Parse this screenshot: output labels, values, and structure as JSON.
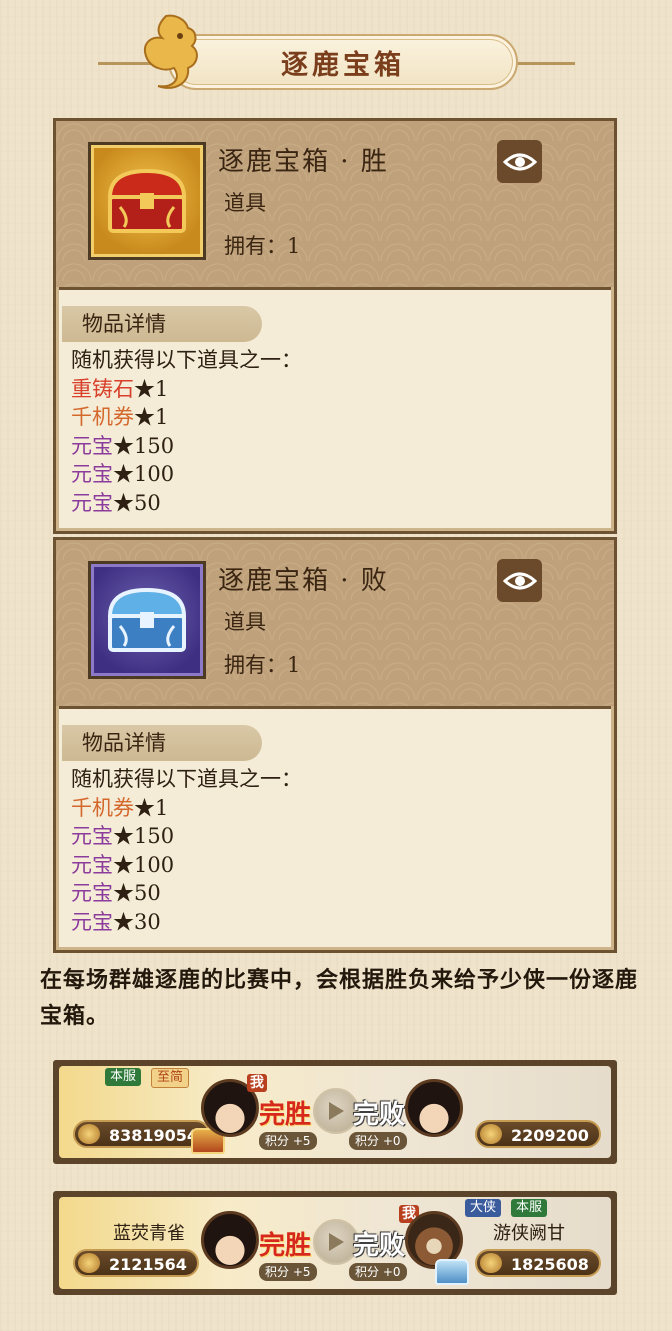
{
  "header": {
    "title": "逐鹿宝箱",
    "icon": "golden-bird-icon"
  },
  "cards": [
    {
      "name": "逐鹿宝箱 · 胜",
      "type": "道具",
      "owned": "拥有：1",
      "chest_color": "gold",
      "detail_tab": "物品详情",
      "intro": "随机获得以下道具之一：",
      "rewards": [
        {
          "text": "重铸石",
          "qty": "★1",
          "color": "#d8402b"
        },
        {
          "text": "千机券",
          "qty": "★1",
          "color": "#d4682c"
        },
        {
          "text": "元宝",
          "qty": "★150",
          "color": "#8b3b9c"
        },
        {
          "text": "元宝",
          "qty": "★100",
          "color": "#8b3b9c"
        },
        {
          "text": "元宝",
          "qty": "★50",
          "color": "#8b3b9c"
        }
      ]
    },
    {
      "name": "逐鹿宝箱 · 败",
      "type": "道具",
      "owned": "拥有：1",
      "chest_color": "blue",
      "detail_tab": "物品详情",
      "intro": "随机获得以下道具之一：",
      "rewards": [
        {
          "text": "千机券",
          "qty": "★1",
          "color": "#d4682c"
        },
        {
          "text": "元宝",
          "qty": "★150",
          "color": "#8b3b9c"
        },
        {
          "text": "元宝",
          "qty": "★100",
          "color": "#8b3b9c"
        },
        {
          "text": "元宝",
          "qty": "★50",
          "color": "#8b3b9c"
        },
        {
          "text": "元宝",
          "qty": "★30",
          "color": "#8b3b9c"
        }
      ]
    }
  ],
  "description": "在每场群雄逐鹿的比赛中，会根据胜负来给予少侠一份逐鹿宝箱。",
  "matches": [
    {
      "left": {
        "server_tag": "本服",
        "rank_tag": "至简",
        "score": "83819054",
        "me_badge": "我"
      },
      "right": {
        "score": "2209200"
      },
      "win_label": "完胜",
      "lose_label": "完败",
      "win_points": "积分 +5",
      "lose_points": "积分 +0"
    },
    {
      "left": {
        "name": "蓝荧青雀",
        "score": "2121564"
      },
      "right": {
        "name": "游侠阙甘",
        "rank_tag": "大侠",
        "server_tag": "本服",
        "score": "1825608",
        "me_badge": "我"
      },
      "win_label": "完胜",
      "lose_label": "完败",
      "win_points": "积分 +5",
      "lose_points": "积分 +0"
    }
  ],
  "colors": {
    "win": "#d7281d",
    "panel_border": "#6e5332",
    "accent_gold": "#f2c34c"
  }
}
